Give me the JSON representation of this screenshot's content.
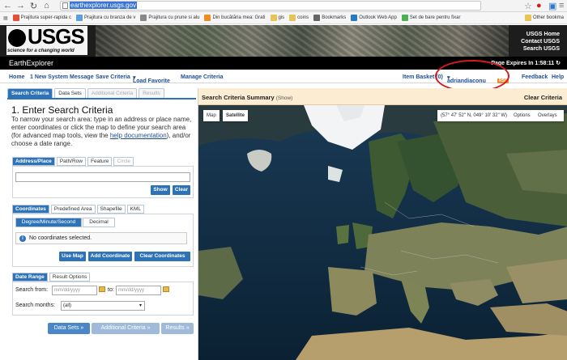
{
  "browser": {
    "url_text": "earthexplorer.usgs.gov",
    "bookmarks": [
      {
        "label": "Prajitura super-rapida c",
        "color": "#e44f3a"
      },
      {
        "label": "Prajitura cu branza de v",
        "color": "#5aa0e0"
      },
      {
        "label": "Prajitura cu prune si alu",
        "color": "#888888"
      },
      {
        "label": "Din bucătăria mea: Grati",
        "color": "#f08a24"
      },
      {
        "label": "gis",
        "color": "#e8c35a"
      },
      {
        "label": "coins",
        "color": "#e8c35a"
      },
      {
        "label": "Bookmarks",
        "color": "#666666"
      },
      {
        "label": "Outlook Web App",
        "color": "#2b78c5"
      },
      {
        "label": "Set de bare pentru fixar",
        "color": "#4caf50"
      }
    ],
    "other_bookmarks": "Other bookma"
  },
  "header": {
    "logo": "USGS",
    "tagline": "science for a changing world",
    "links": [
      "USGS Home",
      "Contact USGS",
      "Search USGS"
    ]
  },
  "app": {
    "title": "EarthExplorer",
    "expires": "Page Expires In 1:58:11"
  },
  "nav": {
    "home": "Home",
    "new_message": "1 New System Message",
    "save_criteria": "Save Criteria",
    "load_favorite": "Load Favorite",
    "manage_criteria": "Manage Criteria",
    "item_basket": "Item Basket (0)",
    "user": "adriandiaconu",
    "rss": "RSS",
    "feedback": "Feedback",
    "help": "Help"
  },
  "tabs": [
    "Search Criteria",
    "Data Sets",
    "Additional Criteria",
    "Results"
  ],
  "search": {
    "title": "1. Enter Search Criteria",
    "instructions_prefix": "To narrow your search area: type in an address or place name, enter coordinates or click the map to define your search area (for advanced map tools, view the ",
    "help_link": "help documentation",
    "instructions_suffix": "), and/or choose a date range.",
    "addr_tabs": [
      "Address/Place",
      "Path/Row",
      "Feature",
      "Circle"
    ],
    "show_btn": "Show",
    "clear_btn": "Clear",
    "coord_tabs": [
      "Coordinates",
      "Predefined Area",
      "Shapefile",
      "KML"
    ],
    "coord_modes": [
      "Degree/Minute/Second",
      "Decimal"
    ],
    "no_coords": "No coordinates selected.",
    "use_map": "Use Map",
    "add_coord": "Add Coordinate",
    "clear_coords": "Clear Coordinates",
    "date_tabs": [
      "Date Range",
      "Result Options"
    ],
    "search_from": "Search from:",
    "date_placeholder": "mm/dd/yyyy",
    "to": "to:",
    "search_months": "Search months:",
    "months_value": "(all)",
    "footer_btns": [
      "Data Sets »",
      "Additional Criteria »",
      "Results »"
    ]
  },
  "map": {
    "summary": "Search Criteria Summary",
    "show": "(Show)",
    "clear": "Clear Criteria",
    "type_map": "Map",
    "type_satellite": "Satellite",
    "coords": "(57° 47' 52\" N, 049° 10' 32\" W)",
    "options": "Options",
    "overlays": "Overlays"
  }
}
